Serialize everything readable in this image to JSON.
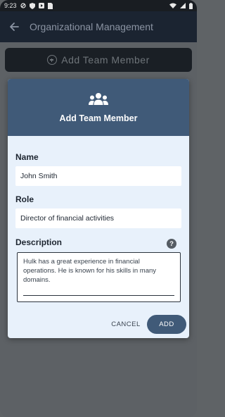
{
  "status_bar": {
    "time": "9:23"
  },
  "app_bar": {
    "title": "Organizational Management"
  },
  "add_member_button": {
    "label": "Add Team Member"
  },
  "dialog": {
    "title": "Add Team Member",
    "fields": {
      "name": {
        "label": "Name",
        "value": "John Smith"
      },
      "role": {
        "label": "Role",
        "value": "Director of financial activities"
      },
      "description": {
        "label": "Description",
        "value": "Hulk has a great experience in financial operations. He is known for his skills in many domains."
      }
    },
    "help_icon_text": "?",
    "cancel_label": "CANCEL",
    "add_label": "ADD"
  },
  "colors": {
    "app_bar_bg": "#1b2431",
    "dialog_header_bg": "#405a78",
    "dialog_bg": "#e8f1fb",
    "scrim": "#5d6165"
  },
  "icons": {
    "back": "arrow-left-icon",
    "group": "group-icon",
    "add": "plus-circle-icon",
    "help": "help-icon"
  }
}
